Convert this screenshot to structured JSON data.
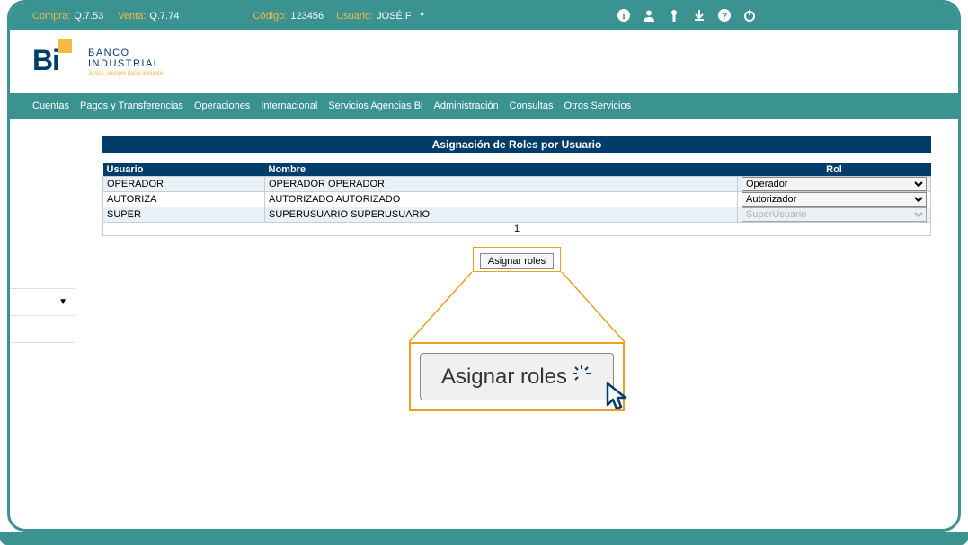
{
  "topBar": {
    "compraLabel": "Compra:",
    "compraValue": "Q.7.53",
    "ventaLabel": "Venta:",
    "ventaValue": "Q.7.74",
    "codigoLabel": "Código:",
    "codigoValue": "123456",
    "usuarioLabel": "Usuario:",
    "usuarioValue": "JOSÉ F"
  },
  "logo": {
    "title1": "BANCO",
    "title2": "INDUSTRIAL",
    "subtitle": "Juntos, siempre hacia adelante"
  },
  "nav": {
    "items": [
      "Cuentas",
      "Pagos y Transferencias",
      "Operaciones",
      "Internacional",
      "Servicios Agencias Bi",
      "Administración",
      "Consultas",
      "Otros Servicios"
    ]
  },
  "page": {
    "title": "Asignación de Roles por Usuario"
  },
  "table": {
    "headers": {
      "usuario": "Usuario",
      "nombre": "Nombre",
      "rol": "Rol"
    },
    "rows": [
      {
        "usuario": "OPERADOR",
        "nombre": "OPERADOR OPERADOR",
        "rol": "Operador",
        "disabled": false
      },
      {
        "usuario": "AUTORIZA",
        "nombre": "AUTORIZADO AUTORIZADO",
        "rol": "Autorizador",
        "disabled": false
      },
      {
        "usuario": "SUPER",
        "nombre": "SUPERUSUARIO SUPERUSUARIO",
        "rol": "SuperUsuario",
        "disabled": true
      }
    ],
    "roleOptions": [
      "Operador",
      "Autorizador",
      "SuperUsuario"
    ]
  },
  "pagination": {
    "page": "1"
  },
  "buttons": {
    "assign": "Asignar roles"
  },
  "zoom": {
    "assign": "Asignar roles"
  }
}
